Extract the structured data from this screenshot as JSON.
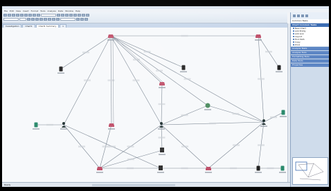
{
  "menu": [
    "File",
    "Edit",
    "View",
    "Insert",
    "Format",
    "Tools",
    "Analysis",
    "Data",
    "Window",
    "Help"
  ],
  "tabs": [
    "Investigation",
    "Chart1",
    "Chart1 Summary",
    "x"
  ],
  "canvas": {
    "nodes": [
      {
        "label": "",
        "icon": "car-icon",
        "color": "#c0506a"
      },
      {
        "label": "",
        "icon": "car-icon",
        "color": "#c0506a"
      },
      {
        "label": "",
        "icon": "phone-icon",
        "color": "#222"
      },
      {
        "label": "",
        "icon": "phone-icon",
        "color": "#222"
      },
      {
        "label": "",
        "icon": "car-icon",
        "color": "#c0506a"
      },
      {
        "label": "",
        "icon": "person-icon",
        "color": "#233"
      },
      {
        "label": "",
        "icon": "car-icon",
        "color": "#c0506a"
      },
      {
        "label": "",
        "icon": "person-icon",
        "color": "#233"
      },
      {
        "label": "",
        "icon": "globe-icon",
        "color": "#4d8c60"
      },
      {
        "label": "",
        "icon": "person-icon",
        "color": "#233"
      },
      {
        "label": "",
        "icon": "phone-icon",
        "color": "#2a8a6c"
      },
      {
        "label": "",
        "icon": "phone-icon",
        "color": "#222"
      },
      {
        "label": "",
        "icon": "phone-icon",
        "color": "#2a8a6c"
      },
      {
        "label": "",
        "icon": "building-icon",
        "color": "#333"
      },
      {
        "label": "",
        "icon": "car-icon",
        "color": "#c0506a"
      },
      {
        "label": "",
        "icon": "bank-icon",
        "color": "#333"
      },
      {
        "label": "",
        "icon": "car-icon",
        "color": "#c0506a"
      },
      {
        "label": "",
        "icon": "phone-icon",
        "color": "#222"
      },
      {
        "label": "",
        "icon": "phone-icon",
        "color": "#2a8a6c"
      }
    ]
  },
  "panel": {
    "head_title": "Common Tasks",
    "groups": [
      {
        "title": "Chart Common Tasks",
        "items": [
          "New Chart",
          "Add Entity",
          "Add Link",
          "Layout",
          "Find Path",
          "Copy",
          "Print"
        ]
      },
      {
        "title": "Analysis Tasks",
        "items": []
      },
      {
        "title": "Analysis Tools",
        "items": []
      },
      {
        "title": "Formatting Tools",
        "items": []
      },
      {
        "title": "Data Tools",
        "items": []
      },
      {
        "title": "Properties",
        "items": []
      }
    ]
  },
  "status": {
    "left": "Ready",
    "mid": "",
    "right": ""
  }
}
